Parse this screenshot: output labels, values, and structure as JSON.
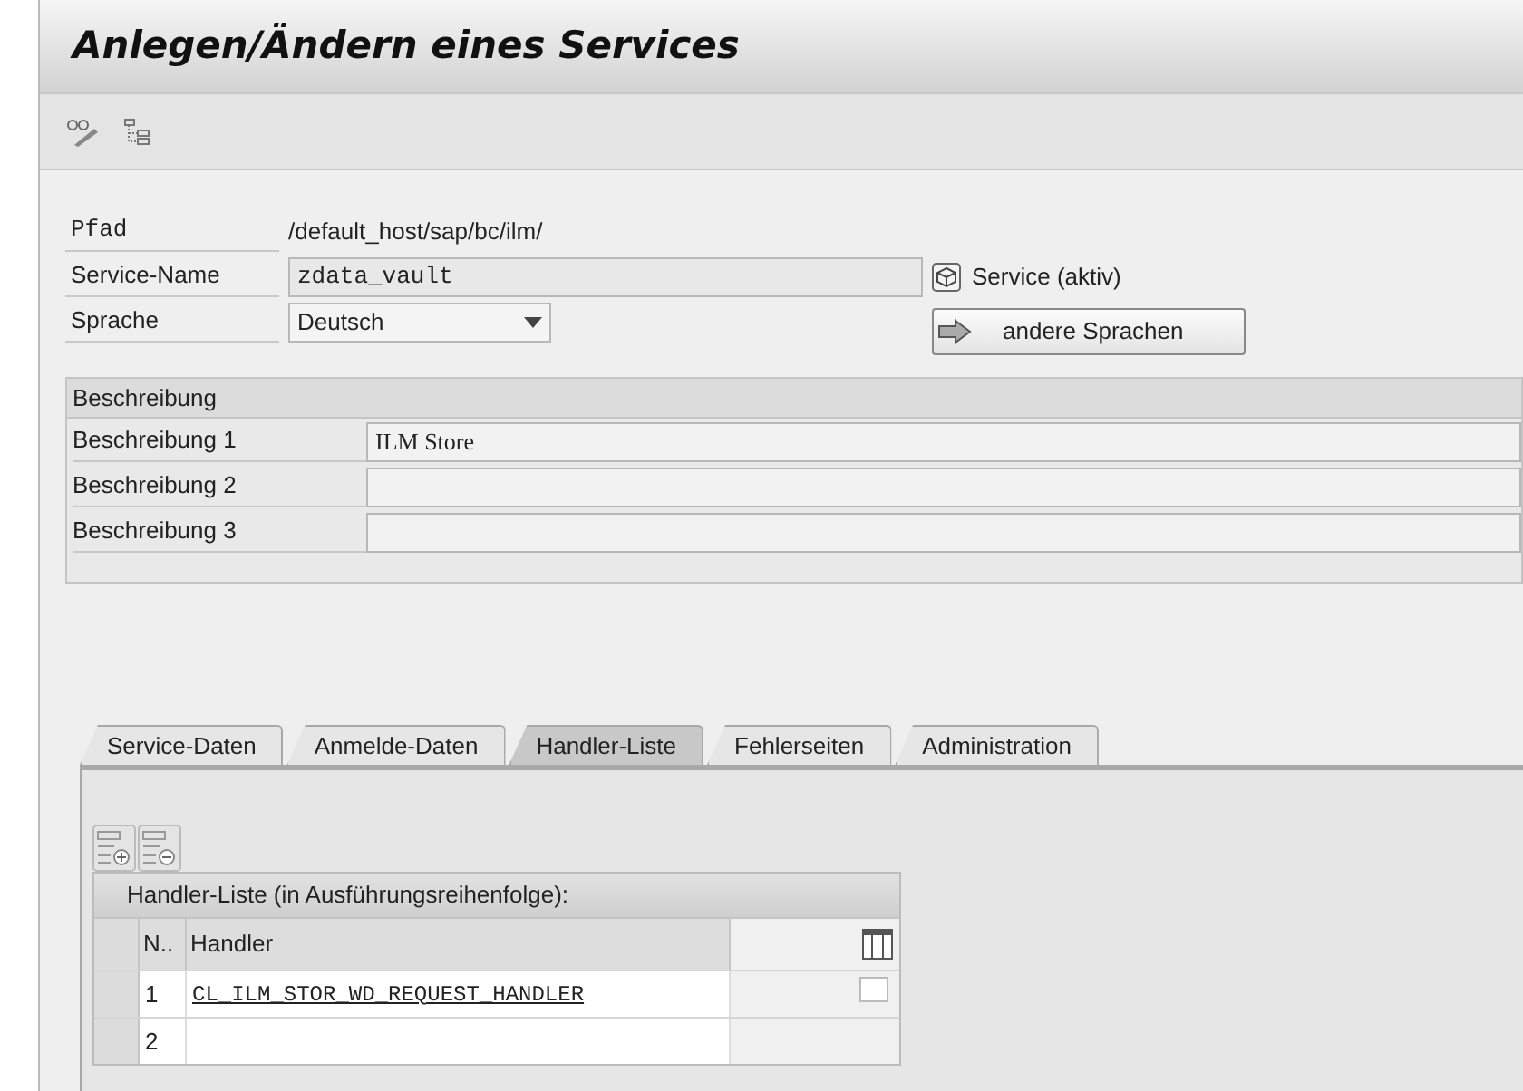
{
  "window": {
    "title": "Anlegen/Ändern eines Services"
  },
  "header_fields": [
    {
      "label": "Pfad",
      "value": "/default_host/sap/bc/ilm/",
      "kind": "text"
    },
    {
      "label": "Service-Name",
      "value": "zdata_vault",
      "kind": "input",
      "status": "Service (aktiv)"
    },
    {
      "label": "Sprache",
      "value": "Deutsch",
      "kind": "dropdown",
      "button": "andere Sprachen"
    }
  ],
  "description_group": {
    "title": "Beschreibung",
    "rows": [
      {
        "label": "Beschreibung 1",
        "value": "ILM Store"
      },
      {
        "label": "Beschreibung 2"
      },
      {
        "label": "Beschreibung 3"
      }
    ]
  },
  "tabs": [
    {
      "label": "Service-Daten",
      "selected": false
    },
    {
      "label": "Anmelde-Daten",
      "selected": false
    },
    {
      "label": "Handler-Liste",
      "selected": true
    },
    {
      "label": "Fehlerseiten",
      "selected": false
    },
    {
      "label": "Administration",
      "selected": false
    }
  ],
  "table": {
    "title": "Handler-Liste (in Ausführungsreihenfolge):",
    "columns": [
      "N..",
      "Handler"
    ],
    "rows": [
      {
        "number": "1",
        "handler": "CL_ILM_STOR_WD_REQUEST_HANDLER"
      },
      {
        "number": "2"
      }
    ]
  }
}
